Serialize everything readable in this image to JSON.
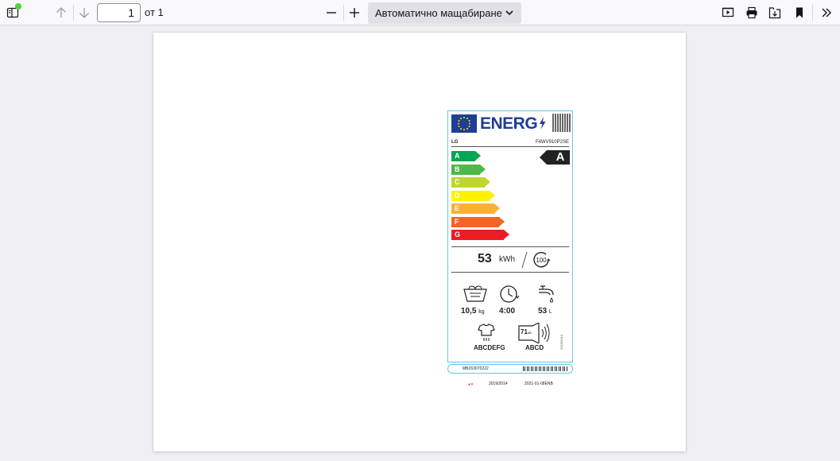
{
  "toolbar": {
    "sidebar_toggle_icon": "sidebar-toggle-icon",
    "prev_icon": "arrow-up-icon",
    "next_icon": "arrow-down-icon",
    "page_number": "1",
    "page_count": "от 1",
    "zoom_out_icon": "minus-icon",
    "zoom_in_icon": "plus-icon",
    "zoom_value": "Автоматично мащабиране",
    "presentation_icon": "presentation-icon",
    "print_icon": "print-icon",
    "save_icon": "save-icon",
    "bookmark_icon": "bookmark-icon",
    "more_icon": "double-chevron-right-icon",
    "notification_color": "#54ce3f"
  },
  "document": {
    "energy_label": {
      "title": "ENERG",
      "brand": "LG",
      "model": "F4WV910P2SE",
      "classes": [
        {
          "letter": "A",
          "color": "#00a651"
        },
        {
          "letter": "B",
          "color": "#50b848"
        },
        {
          "letter": "C",
          "color": "#bed630"
        },
        {
          "letter": "D",
          "color": "#fff200"
        },
        {
          "letter": "E",
          "color": "#fbb034"
        },
        {
          "letter": "F",
          "color": "#f26522"
        },
        {
          "letter": "G",
          "color": "#ed1c24"
        }
      ],
      "rating": "A",
      "energy_value": "53",
      "energy_unit": "kWh",
      "cycles": "100",
      "capacity_value": "10,5",
      "capacity_unit": "kg",
      "duration": "4:00",
      "water_value": "53",
      "water_unit": "L",
      "spin_class": "ABCDEFG",
      "noise_db": "71",
      "noise_unit": "dB",
      "noise_class": "ABCD",
      "regulation": "2019/2014",
      "bottom_code": "MBZ63070222",
      "footer_left": "2019/2014",
      "footer_right": "2021-01-08ENB"
    }
  }
}
